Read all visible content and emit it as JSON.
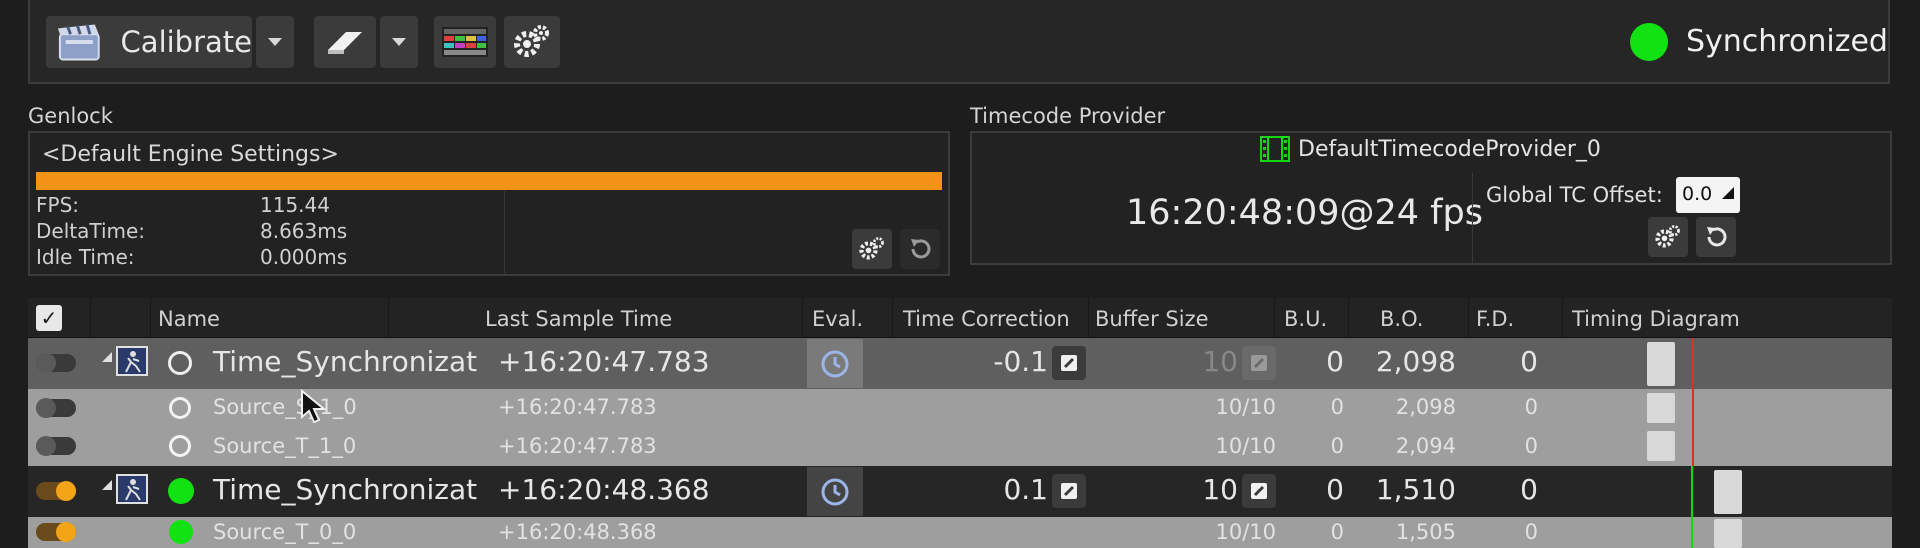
{
  "toolbar": {
    "calibrate_label": "Calibrate",
    "status_label": "Synchronized",
    "status_color": "#12e212",
    "icons": [
      "clapperboard-icon",
      "eraser-icon",
      "color-bars-icon",
      "gears-icon"
    ]
  },
  "genlock": {
    "title": "Genlock",
    "source": "<Default Engine Settings>",
    "bar_color": "#f29318",
    "stats": [
      {
        "key": "FPS:",
        "value": "115.44"
      },
      {
        "key": "DeltaTime:",
        "value": "8.663ms"
      },
      {
        "key": "Idle Time:",
        "value": "0.000ms"
      }
    ]
  },
  "timecode": {
    "title": "Timecode Provider",
    "provider_name": "DefaultTimecodeProvider_0",
    "time": "16:20:48:09@24 fps",
    "offset_label": "Global TC Offset:",
    "offset_value": "0.0"
  },
  "table": {
    "headers": {
      "name": "Name",
      "last_sample": "Last Sample Time",
      "eval": "Eval.",
      "time_correction": "Time Correction",
      "buffer_size": "Buffer Size",
      "bu": "B.U.",
      "bo": "B.O.",
      "fd": "F.D.",
      "timing": "Timing Diagram"
    },
    "rows": [
      {
        "name": "Time_Synchronizat",
        "time": "+16:20:47.783",
        "correction": "-0.1",
        "buffer": "10",
        "bu": "0",
        "bo": "2,098",
        "fd": "0"
      },
      {
        "name": "Source_S_1_0",
        "time": "+16:20:47.783",
        "buffer": "10/10",
        "bu": "0",
        "bo": "2,098",
        "fd": "0"
      },
      {
        "name": "Source_T_1_0",
        "time": "+16:20:47.783",
        "buffer": "10/10",
        "bu": "0",
        "bo": "2,094",
        "fd": "0"
      },
      {
        "name": "Time_Synchronizat",
        "time": "+16:20:48.368",
        "correction": "0.1",
        "buffer": "10",
        "bu": "0",
        "bo": "1,510",
        "fd": "0"
      },
      {
        "name": "Source_T_0_0",
        "time": "+16:20:48.368",
        "buffer": "10/10",
        "bu": "0",
        "bo": "1,505",
        "fd": "0"
      }
    ]
  }
}
